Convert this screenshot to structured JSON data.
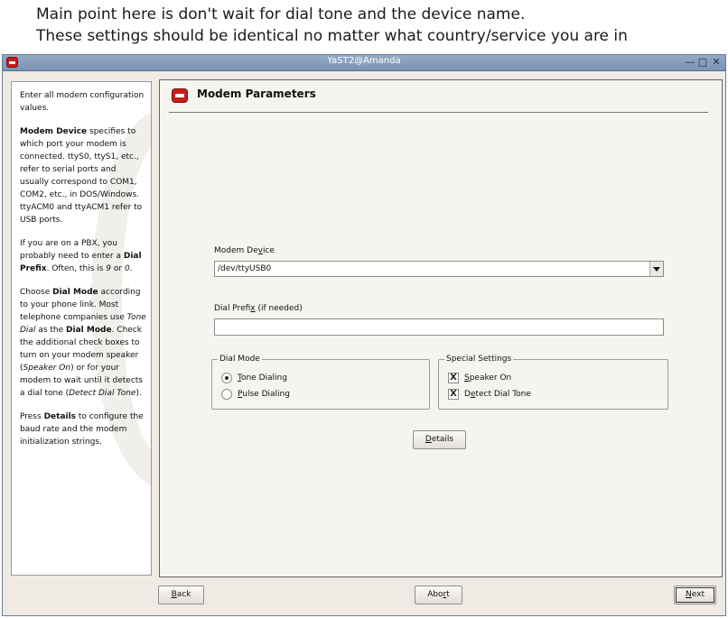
{
  "caption": {
    "line1": "Main point here is don't wait for dial tone and the device name.",
    "line2": "These settings should be identical no matter what country/service you are in"
  },
  "window": {
    "title": "YaST2@Amanda",
    "buttons": {
      "minimize": "—",
      "maximize": "□",
      "close": "✕"
    }
  },
  "help": {
    "p1": "Enter all modem configuration values.",
    "p2_bold": "Modem Device",
    "p2": " specifies to which port your modem is connected. ttyS0, ttyS1, etc., refer to serial ports and usually correspond to COM1, COM2, etc., in DOS/Windows. ttyACM0 and ttyACM1 refer to USB ports.",
    "p3_a": "If you are on a PBX, you probably need to enter a ",
    "p3_bold": "Dial Prefix",
    "p3_b": ". Often, this is ",
    "p3_i1": "9",
    "p3_c": " or ",
    "p3_i2": "0",
    "p3_d": ".",
    "p4_a": "Choose ",
    "p4_bold1": "Dial Mode",
    "p4_b": " according to your phone link. Most telephone companies use ",
    "p4_i1": "Tone Dial",
    "p4_c": " as the ",
    "p4_bold2": "Dial Mode",
    "p4_d": ". Check the additional check boxes to turn on your modem speaker (",
    "p4_i2": "Speaker On",
    "p4_e": ") or for your modem to wait until it detects a dial tone (",
    "p4_i3": "Detect Dial Tone",
    "p4_f": ").",
    "p5_a": "Press ",
    "p5_bold": "Details",
    "p5_b": " to configure the baud rate and the modem initialization strings."
  },
  "page": {
    "icon": "phone-icon",
    "title": "Modem Parameters"
  },
  "modem_device": {
    "label_a": "Modem De",
    "label_u": "v",
    "label_b": "ice",
    "value": "/dev/ttyUSB0"
  },
  "dial_prefix": {
    "label_a": "Dial Prefi",
    "label_u": "x",
    "label_b": " (if needed)",
    "value": ""
  },
  "dial_mode": {
    "title": "Dial Mode",
    "tone_u": "T",
    "tone_rest": "one Dialing",
    "tone_selected": true,
    "pulse_u": "P",
    "pulse_rest": "ulse Dialing"
  },
  "special": {
    "title": "Special Settings",
    "speaker_u": "S",
    "speaker_rest": "peaker On",
    "speaker_checked": true,
    "detect_a": "D",
    "detect_u": "e",
    "detect_b": "tect Dial Tone",
    "detect_checked": true,
    "check_mark": "X"
  },
  "details_button": {
    "u": "D",
    "rest": "etails"
  },
  "footer": {
    "back_u": "B",
    "back_rest": "ack",
    "abort_a": "Abo",
    "abort_u": "r",
    "abort_b": "t",
    "next_u": "N",
    "next_rest": "ext"
  }
}
